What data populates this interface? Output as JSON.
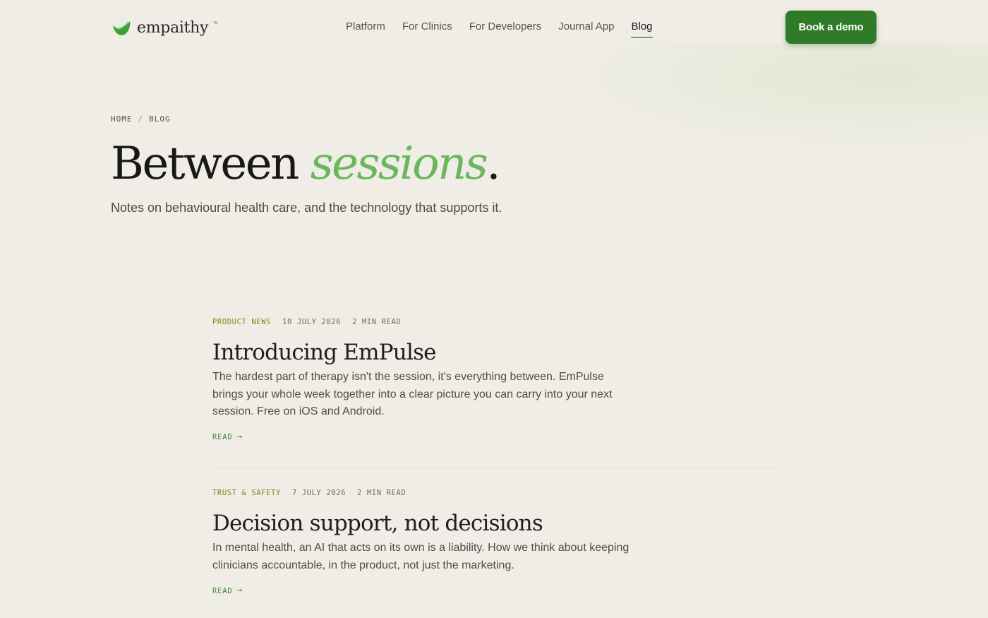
{
  "brand": {
    "name": "empaithy",
    "tm": "™",
    "logo_icon": "leaf-icon",
    "colors": {
      "primary": "#2f7a26",
      "accent": "#6ab75d",
      "category": "#8a7f16",
      "background": "#f0ede6"
    }
  },
  "nav": {
    "items": [
      {
        "label": "Platform",
        "active": false
      },
      {
        "label": "For Clinics",
        "active": false
      },
      {
        "label": "For Developers",
        "active": false
      },
      {
        "label": "Journal App",
        "active": false
      },
      {
        "label": "Blog",
        "active": true
      }
    ],
    "cta_label": "Book a demo"
  },
  "breadcrumb": {
    "home": "HOME",
    "separator": "/",
    "current": "BLOG"
  },
  "hero": {
    "title_main": "Between",
    "title_accent": "sessions",
    "title_end": ".",
    "subtitle": "Notes on behavioural health care, and the technology that supports it."
  },
  "posts": [
    {
      "category": "PRODUCT NEWS",
      "date": "10 JULY 2026",
      "read_time": "2 MIN READ",
      "title": "Introducing EmPulse",
      "excerpt": "The hardest part of therapy isn't the session, it's everything between. EmPulse brings your whole week together into a clear picture you can carry into your next session. Free on iOS and Android.",
      "read_label": "READ",
      "arrow": "→"
    },
    {
      "category": "TRUST & SAFETY",
      "date": "7 JULY 2026",
      "read_time": "2 MIN READ",
      "title": "Decision support, not decisions",
      "excerpt": "In mental health, an AI that acts on its own is a liability. How we think about keeping clinicians accountable, in the product, not just the marketing.",
      "read_label": "READ",
      "arrow": "→"
    }
  ]
}
